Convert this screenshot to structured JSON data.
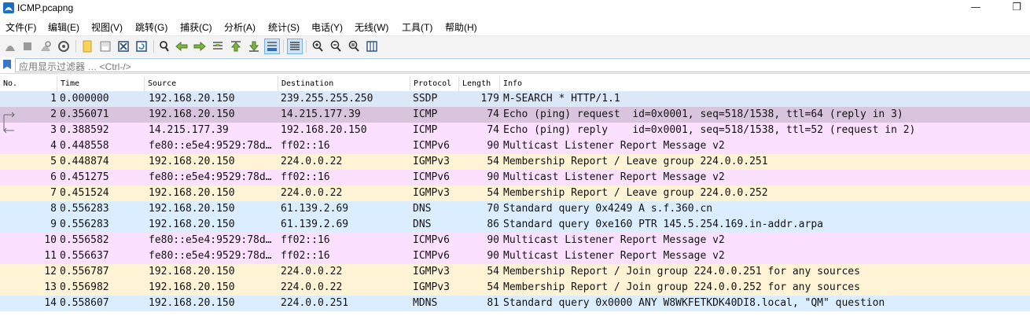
{
  "window": {
    "title": "ICMP.pcapng",
    "minimize": "—",
    "restore": "❐"
  },
  "menu": [
    "文件(F)",
    "编辑(E)",
    "视图(V)",
    "跳转(G)",
    "捕获(C)",
    "分析(A)",
    "统计(S)",
    "电话(Y)",
    "无线(W)",
    "工具(T)",
    "帮助(H)"
  ],
  "toolbar": [
    {
      "icon": "shark-fin-start-icon"
    },
    {
      "icon": "stop-icon"
    },
    {
      "icon": "restart-icon"
    },
    {
      "icon": "capture-options-icon"
    },
    {
      "icon": "open-file-icon"
    },
    {
      "icon": "save-file-icon"
    },
    {
      "icon": "close-file-icon"
    },
    {
      "icon": "reload-icon"
    },
    {
      "icon": "find-icon"
    },
    {
      "icon": "go-back-icon"
    },
    {
      "icon": "go-forward-icon"
    },
    {
      "icon": "go-to-packet-icon"
    },
    {
      "icon": "first-packet-icon"
    },
    {
      "icon": "last-packet-icon"
    },
    {
      "icon": "autoscroll-icon",
      "pressed": true
    },
    {
      "icon": "colorize-icon",
      "pressed": true
    },
    {
      "icon": "zoom-in-icon"
    },
    {
      "icon": "zoom-out-icon"
    },
    {
      "icon": "normal-size-icon"
    },
    {
      "icon": "resize-columns-icon"
    }
  ],
  "filter": {
    "placeholder": "应用显示过滤器 … <Ctrl-/>"
  },
  "columns": {
    "no": "No.",
    "time": "Time",
    "source": "Source",
    "destination": "Destination",
    "protocol": "Protocol",
    "length": "Length",
    "info": "Info"
  },
  "colors": {
    "ssdp": "#dae8f8",
    "icmp": "#fce0ff",
    "icmp_selected": "#d8c5dd",
    "igmp": "#fff3d6",
    "dns": "#daeeff",
    "mdns": "#daeeff"
  },
  "packets": [
    {
      "no": "1",
      "time": "0.000000",
      "source": "192.168.20.150",
      "destination": "239.255.255.250",
      "protocol": "SSDP",
      "length": "179",
      "info": "M-SEARCH * HTTP/1.1",
      "color": "#dae8f8"
    },
    {
      "no": "2",
      "time": "0.356071",
      "source": "192.168.20.150",
      "destination": "14.215.177.39",
      "protocol": "ICMP",
      "length": "74",
      "info": "Echo (ping) request  id=0x0001, seq=518/1538, ttl=64 (reply in 3)",
      "color": "#d8c5dd",
      "related": "request"
    },
    {
      "no": "3",
      "time": "0.388592",
      "source": "14.215.177.39",
      "destination": "192.168.20.150",
      "protocol": "ICMP",
      "length": "74",
      "info": "Echo (ping) reply    id=0x0001, seq=518/1538, ttl=52 (request in 2)",
      "color": "#fce0ff",
      "related": "reply"
    },
    {
      "no": "4",
      "time": "0.448558",
      "source": "fe80::e5e4:9529:78d…",
      "destination": "ff02::16",
      "protocol": "ICMPv6",
      "length": "90",
      "info": "Multicast Listener Report Message v2",
      "color": "#fce0ff"
    },
    {
      "no": "5",
      "time": "0.448874",
      "source": "192.168.20.150",
      "destination": "224.0.0.22",
      "protocol": "IGMPv3",
      "length": "54",
      "info": "Membership Report / Leave group 224.0.0.251",
      "color": "#fff3d6"
    },
    {
      "no": "6",
      "time": "0.451275",
      "source": "fe80::e5e4:9529:78d…",
      "destination": "ff02::16",
      "protocol": "ICMPv6",
      "length": "90",
      "info": "Multicast Listener Report Message v2",
      "color": "#fce0ff"
    },
    {
      "no": "7",
      "time": "0.451524",
      "source": "192.168.20.150",
      "destination": "224.0.0.22",
      "protocol": "IGMPv3",
      "length": "54",
      "info": "Membership Report / Leave group 224.0.0.252",
      "color": "#fff3d6"
    },
    {
      "no": "8",
      "time": "0.556283",
      "source": "192.168.20.150",
      "destination": "61.139.2.69",
      "protocol": "DNS",
      "length": "70",
      "info": "Standard query 0x4249 A s.f.360.cn",
      "color": "#daeeff"
    },
    {
      "no": "9",
      "time": "0.556283",
      "source": "192.168.20.150",
      "destination": "61.139.2.69",
      "protocol": "DNS",
      "length": "86",
      "info": "Standard query 0xe160 PTR 145.5.254.169.in-addr.arpa",
      "color": "#daeeff"
    },
    {
      "no": "10",
      "time": "0.556582",
      "source": "fe80::e5e4:9529:78d…",
      "destination": "ff02::16",
      "protocol": "ICMPv6",
      "length": "90",
      "info": "Multicast Listener Report Message v2",
      "color": "#fce0ff"
    },
    {
      "no": "11",
      "time": "0.556637",
      "source": "fe80::e5e4:9529:78d…",
      "destination": "ff02::16",
      "protocol": "ICMPv6",
      "length": "90",
      "info": "Multicast Listener Report Message v2",
      "color": "#fce0ff"
    },
    {
      "no": "12",
      "time": "0.556787",
      "source": "192.168.20.150",
      "destination": "224.0.0.22",
      "protocol": "IGMPv3",
      "length": "54",
      "info": "Membership Report / Join group 224.0.0.251 for any sources",
      "color": "#fff3d6"
    },
    {
      "no": "13",
      "time": "0.556982",
      "source": "192.168.20.150",
      "destination": "224.0.0.22",
      "protocol": "IGMPv3",
      "length": "54",
      "info": "Membership Report / Join group 224.0.0.252 for any sources",
      "color": "#fff3d6"
    },
    {
      "no": "14",
      "time": "0.558607",
      "source": "192.168.20.150",
      "destination": "224.0.0.251",
      "protocol": "MDNS",
      "length": "81",
      "info": "Standard query 0x0000 ANY W8WKFETKDK40DI8.local, \"QM\" question",
      "color": "#daeeff"
    }
  ]
}
